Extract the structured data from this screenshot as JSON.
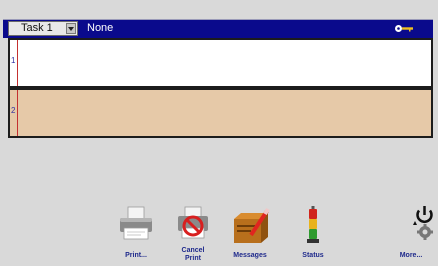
{
  "header": {
    "task_label": "Task 1",
    "status_text": "None"
  },
  "rows": [
    {
      "index": "1"
    },
    {
      "index": "2"
    }
  ],
  "toolbar": {
    "print_label": "Print...",
    "cancel_line1": "Cancel",
    "cancel_line2": "Print",
    "messages_label": "Messages",
    "status_label": "Status",
    "more_label": "More..."
  },
  "colors": {
    "header_bg": "#0a0a8c",
    "row2_bg": "#e6c9a8",
    "label_color": "#1f2a8c"
  },
  "icons": [
    "dropdown-arrow-icon",
    "key-icon",
    "printer-icon",
    "cancel-print-icon",
    "messages-icon",
    "status-light-icon",
    "power-settings-icon"
  ]
}
